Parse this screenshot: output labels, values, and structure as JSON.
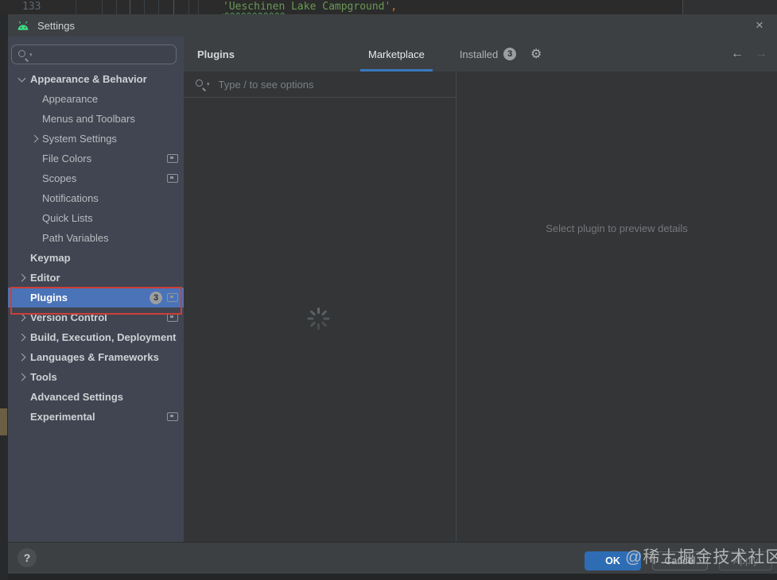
{
  "editor_background": {
    "line_number": "133",
    "code_part_misspelled": "'Ueschinen",
    "code_part_rest": " Lake Campground'",
    "code_comma": ","
  },
  "dialog": {
    "title": "Settings"
  },
  "icons": {
    "close": "×",
    "gear": "⚙",
    "back_arrow": "←",
    "forward_arrow": "→",
    "search_dropdown": "▾",
    "help": "?"
  },
  "sidebar": {
    "search_value": "",
    "items": [
      {
        "label": "Appearance & Behavior",
        "level": 0,
        "bold": true,
        "chevron": "down",
        "badge": null,
        "box_icon": false,
        "selected": false
      },
      {
        "label": "Appearance",
        "level": 1,
        "bold": false,
        "chevron": null,
        "badge": null,
        "box_icon": false,
        "selected": false
      },
      {
        "label": "Menus and Toolbars",
        "level": 1,
        "bold": false,
        "chevron": null,
        "badge": null,
        "box_icon": false,
        "selected": false
      },
      {
        "label": "System Settings",
        "level": 1,
        "bold": false,
        "chevron": "right",
        "badge": null,
        "box_icon": false,
        "selected": false
      },
      {
        "label": "File Colors",
        "level": 1,
        "bold": false,
        "chevron": null,
        "badge": null,
        "box_icon": true,
        "selected": false
      },
      {
        "label": "Scopes",
        "level": 1,
        "bold": false,
        "chevron": null,
        "badge": null,
        "box_icon": true,
        "selected": false
      },
      {
        "label": "Notifications",
        "level": 1,
        "bold": false,
        "chevron": null,
        "badge": null,
        "box_icon": false,
        "selected": false
      },
      {
        "label": "Quick Lists",
        "level": 1,
        "bold": false,
        "chevron": null,
        "badge": null,
        "box_icon": false,
        "selected": false
      },
      {
        "label": "Path Variables",
        "level": 1,
        "bold": false,
        "chevron": null,
        "badge": null,
        "box_icon": false,
        "selected": false
      },
      {
        "label": "Keymap",
        "level": 0,
        "bold": true,
        "chevron": null,
        "badge": null,
        "box_icon": false,
        "selected": false
      },
      {
        "label": "Editor",
        "level": 0,
        "bold": true,
        "chevron": "right",
        "badge": null,
        "box_icon": false,
        "selected": false
      },
      {
        "label": "Plugins",
        "level": 0,
        "bold": true,
        "chevron": null,
        "badge": "3",
        "box_icon": true,
        "selected": true
      },
      {
        "label": "Version Control",
        "level": 0,
        "bold": true,
        "chevron": "right",
        "badge": null,
        "box_icon": true,
        "selected": false
      },
      {
        "label": "Build, Execution, Deployment",
        "level": 0,
        "bold": true,
        "chevron": "right",
        "badge": null,
        "box_icon": false,
        "selected": false
      },
      {
        "label": "Languages & Frameworks",
        "level": 0,
        "bold": true,
        "chevron": "right",
        "badge": null,
        "box_icon": false,
        "selected": false
      },
      {
        "label": "Tools",
        "level": 0,
        "bold": true,
        "chevron": "right",
        "badge": null,
        "box_icon": false,
        "selected": false
      },
      {
        "label": "Advanced Settings",
        "level": 0,
        "bold": true,
        "chevron": null,
        "badge": null,
        "box_icon": false,
        "selected": false
      },
      {
        "label": "Experimental",
        "level": 0,
        "bold": true,
        "chevron": null,
        "badge": null,
        "box_icon": true,
        "selected": false
      }
    ]
  },
  "content": {
    "title": "Plugins",
    "tabs": [
      {
        "label": "Marketplace",
        "active": true,
        "badge": null
      },
      {
        "label": "Installed",
        "active": false,
        "badge": "3"
      }
    ],
    "search_placeholder": "Type / to see options",
    "detail_placeholder": "Select plugin to preview details"
  },
  "footer": {
    "ok_label": "OK",
    "cancel_label": "Cancel",
    "apply_label": "Apply"
  },
  "watermark": "@稀土掘金技术社区",
  "colors": {
    "accent_tab_underline": "#3a78bd",
    "selection_blue": "#4a73b8",
    "ok_button": "#2e6db4",
    "annotation_red": "#cf3e36",
    "android_green": "#3ddc84",
    "sidebar_bg": "#404551",
    "panel_bg": "#333537",
    "chrome_bg": "#3d4043"
  }
}
